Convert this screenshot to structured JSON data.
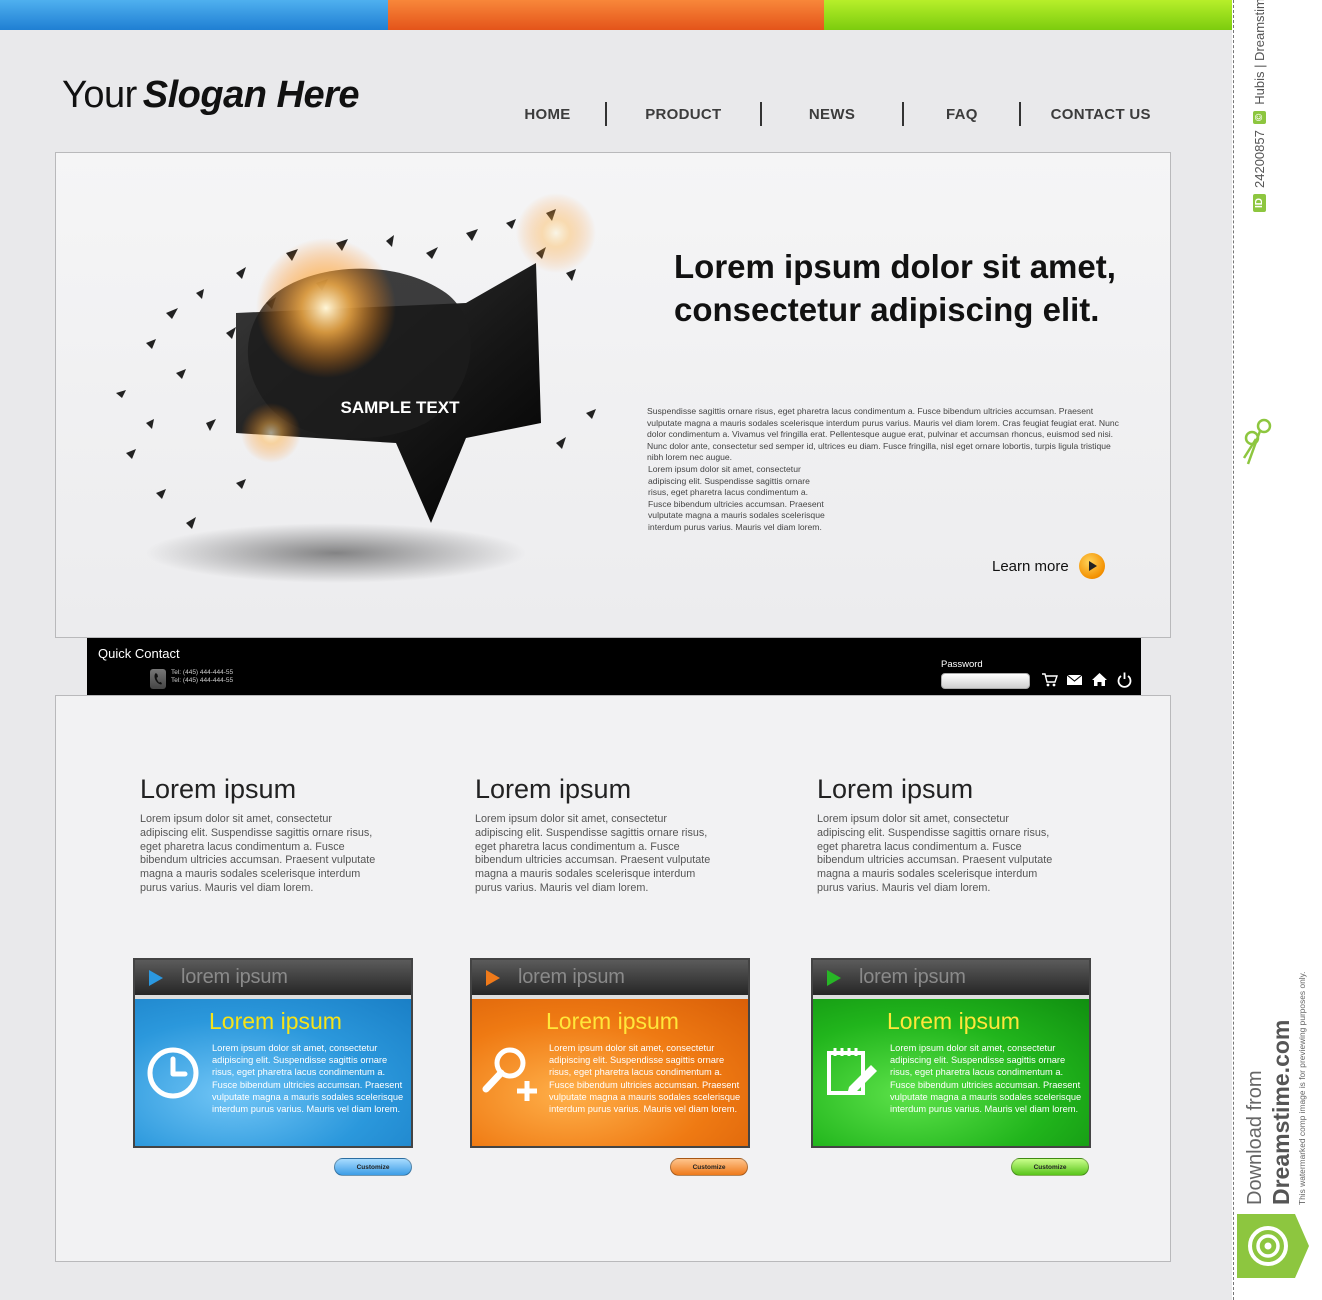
{
  "colors": {
    "blue": "#2b98dc",
    "orange": "#ef7a13",
    "green": "#21b51c",
    "nav_text": "#3c3c3c",
    "bar": "#000000"
  },
  "header": {
    "slogan_plain": "Your",
    "slogan_bold": "Slogan Here"
  },
  "nav": {
    "items": [
      {
        "label": "HOME"
      },
      {
        "label": "PRODUCT"
      },
      {
        "label": "NEWS"
      },
      {
        "label": "FAQ"
      },
      {
        "label": "CONTACT US"
      }
    ]
  },
  "hero": {
    "art_label": "SAMPLE TEXT",
    "title_line1": "Lorem ipsum dolor sit amet,",
    "title_line2": "consectetur adipiscing elit.",
    "paragraph1": "Suspendisse sagittis ornare risus, eget pharetra lacus condimentum a. Fusce bibendum ultricies accumsan. Praesent vulputate magna a mauris sodales scelerisque interdum purus varius. Mauris vel diam lorem. Cras feugiat feugiat erat. Nunc dolor condimentum a. Vivamus vel fringilla erat. Pellentesque augue erat, pulvinar et accumsan rhoncus, euismod sed nisi. Nunc dolor ante, consectetur sed semper id, ultrices eu diam. Fusce fringilla, nisl eget ornare lobortis, turpis ligula tristique nibh lorem nec augue.",
    "paragraph2": "Lorem ipsum dolor sit amet, consectetur adipiscing elit. Suspendisse sagittis ornare risus, eget pharetra lacus condimentum a. Fusce bibendum ultricies accumsan. Praesent vulputate magna a mauris sodales scelerisque interdum purus varius. Mauris vel diam lorem.",
    "learn_more": "Learn more"
  },
  "quick_contact": {
    "title": "Quick Contact",
    "tel1": "Tel: (445) 444-444-55",
    "tel2": "Tel: (445) 444-444-55",
    "password_label": "Password",
    "password_value": "",
    "icons": [
      "cart-icon",
      "mail-icon",
      "home-icon",
      "power-icon"
    ]
  },
  "columns": [
    {
      "title": "Lorem ipsum",
      "text": "Lorem ipsum dolor sit amet, consectetur adipiscing elit. Suspendisse sagittis ornare risus, eget pharetra lacus condimentum a. Fusce bibendum ultricies accumsan. Praesent vulputate magna a mauris sodales scelerisque interdum purus varius. Mauris vel diam lorem."
    },
    {
      "title": "Lorem ipsum",
      "text": "Lorem ipsum dolor sit amet, consectetur adipiscing elit. Suspendisse sagittis ornare risus, eget pharetra lacus condimentum a. Fusce bibendum ultricies accumsan. Praesent vulputate magna a mauris sodales scelerisque interdum purus varius. Mauris vel diam lorem."
    },
    {
      "title": "Lorem ipsum",
      "text": "Lorem ipsum dolor sit amet, consectetur adipiscing elit. Suspendisse sagittis ornare risus, eget pharetra lacus condimentum a. Fusce bibendum ultricies accumsan. Praesent vulputate magna a mauris sodales scelerisque interdum purus varius. Mauris vel diam lorem."
    }
  ],
  "boxes": [
    {
      "header": "lorem ipsum",
      "title": "Lorem ipsum",
      "icon": "clock-icon",
      "text": "Lorem ipsum dolor sit amet, consectetur adipiscing elit. Suspendisse sagittis ornare risus, eget pharetra lacus condimentum a. Fusce bibendum ultricies accumsan. Praesent vulputate magna a mauris sodales scelerisque interdum purus varius. Mauris vel diam lorem.",
      "button": "Customize"
    },
    {
      "header": "lorem ipsum",
      "title": "Lorem ipsum",
      "icon": "zoom-in-icon",
      "text": "Lorem ipsum dolor sit amet, consectetur adipiscing elit. Suspendisse sagittis ornare risus, eget pharetra lacus condimentum a. Fusce bibendum ultricies accumsan. Praesent vulputate magna a mauris sodales scelerisque interdum purus varius. Mauris vel diam lorem.",
      "button": "Customize"
    },
    {
      "header": "lorem ipsum",
      "title": "Lorem ipsum",
      "icon": "notepad-edit-icon",
      "text": "Lorem ipsum dolor sit amet, consectetur adipiscing elit. Suspendisse sagittis ornare risus, eget pharetra lacus condimentum a. Fusce bibendum ultricies accumsan. Praesent vulputate magna a mauris sodales scelerisque interdum purus varius. Mauris vel diam lorem.",
      "button": "Customize"
    }
  ],
  "sidebar": {
    "id_tag": "ID",
    "id_number": "24200857",
    "copyright_symbol": "©",
    "credit": "Hubis | Dreamstime.com",
    "download_line1": "Download from",
    "download_line2": "Dreamstime.com",
    "note": "This watermarked comp image is for previewing purposes only."
  }
}
